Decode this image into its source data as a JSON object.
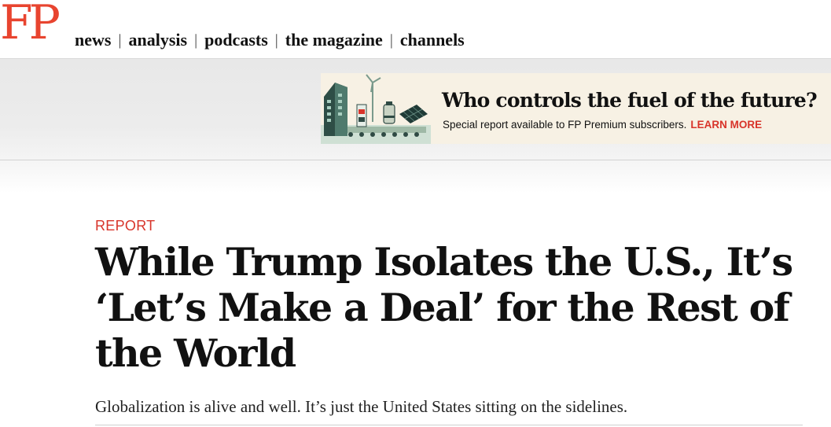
{
  "header": {
    "logo": "FP",
    "nav": [
      "news",
      "analysis",
      "podcasts",
      "the magazine",
      "channels"
    ],
    "separator": "|"
  },
  "ad": {
    "title": "Who controls the fuel of the future?",
    "subtitle": "Special report available to FP Premium subscribers.",
    "cta": "LEARN MORE",
    "accent_color": "#d8342a",
    "background_color": "#f7f1e4"
  },
  "article": {
    "kicker": "REPORT",
    "headline": "While Trump Isolates the U.S., It’s ‘Let’s Make a Deal’ for the Rest of the World",
    "dek": "Globalization is alive and well. It’s just the United States sitting on the sidelines."
  },
  "colors": {
    "brand_red": "#e8442f"
  }
}
